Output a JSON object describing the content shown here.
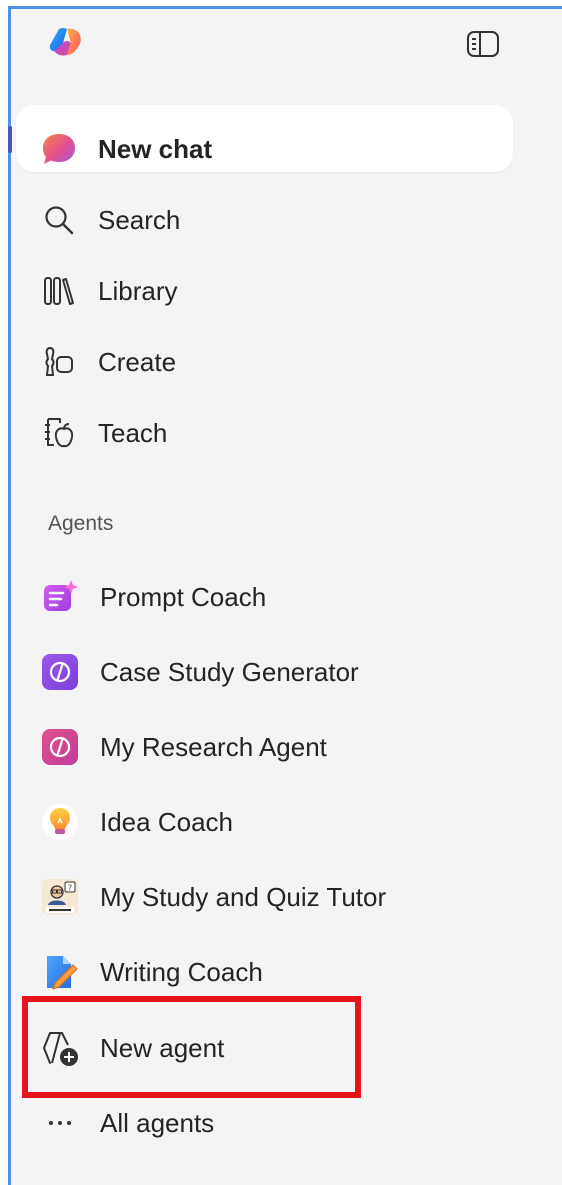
{
  "header": {
    "logo_icon": "copilot-logo-icon",
    "collapse_icon": "sidebar-toggle-icon"
  },
  "nav": {
    "new_chat": "New chat",
    "search": "Search",
    "library": "Library",
    "create": "Create",
    "teach": "Teach"
  },
  "agents": {
    "section_label": "Agents",
    "items": [
      {
        "label": "Prompt Coach",
        "icon": "prompt-coach-icon"
      },
      {
        "label": "Case Study Generator",
        "icon": "agent-code-icon"
      },
      {
        "label": "My Research Agent",
        "icon": "agent-code-icon"
      },
      {
        "label": "Idea Coach",
        "icon": "lightbulb-icon"
      },
      {
        "label": "My Study and Quiz Tutor",
        "icon": "quiz-tutor-icon"
      },
      {
        "label": "Writing Coach",
        "icon": "writing-icon"
      }
    ],
    "new_agent": "New agent",
    "all_agents": "All agents"
  },
  "colors": {
    "accent": "#4b53bc",
    "highlight": "#e8141b",
    "frame": "#4f8fe8",
    "sidebar_bg": "#f4f4f4"
  }
}
